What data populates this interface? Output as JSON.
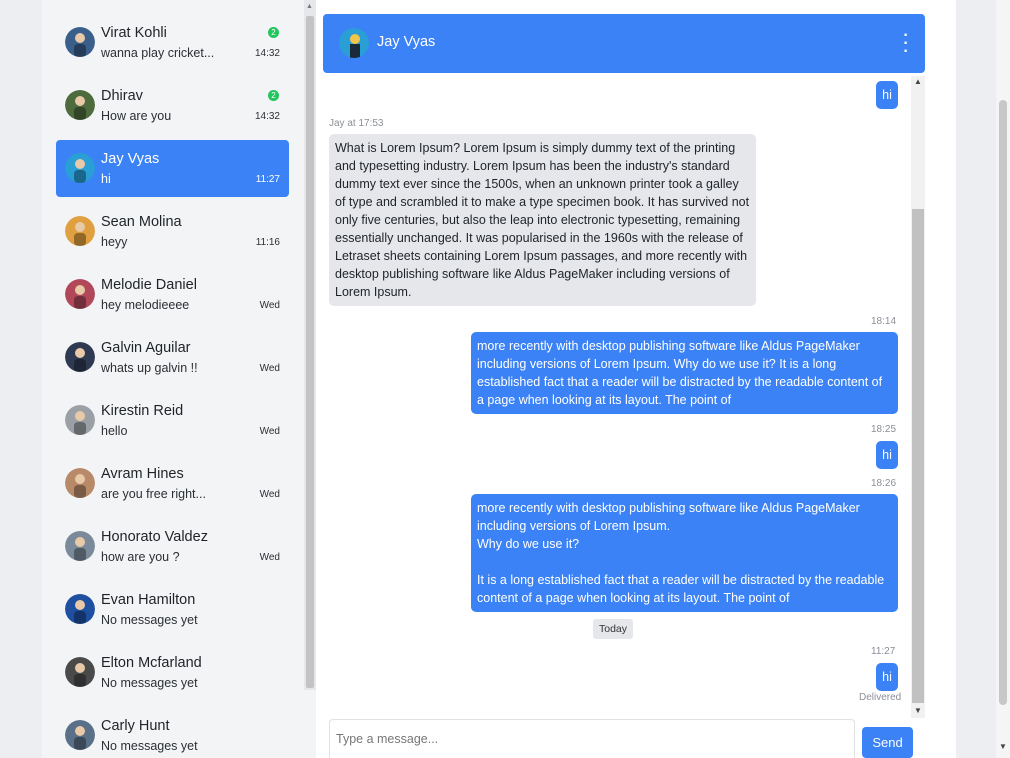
{
  "contacts": [
    {
      "name": "Virat Kohli",
      "preview": "wanna play cricket...",
      "time": "14:32",
      "unread": "2",
      "avatar_color": "#3a5f8a"
    },
    {
      "name": "Dhirav",
      "preview": "How are you",
      "time": "14:32",
      "unread": "2",
      "avatar_color": "#4d6b3c"
    },
    {
      "name": "Jay Vyas",
      "preview": "hi",
      "time": "11:27",
      "unread": "",
      "avatar_color": "#2a9fd6",
      "active": true
    },
    {
      "name": "Sean Molina",
      "preview": "heyy",
      "time": "11:16",
      "unread": "",
      "avatar_color": "#e0a040"
    },
    {
      "name": "Melodie Daniel",
      "preview": "hey melodieeee",
      "time": "Wed",
      "unread": "",
      "avatar_color": "#b0485a"
    },
    {
      "name": "Galvin Aguilar",
      "preview": "whats up galvin !!",
      "time": "Wed",
      "unread": "",
      "avatar_color": "#2e3a52"
    },
    {
      "name": "Kirestin Reid",
      "preview": "hello",
      "time": "Wed",
      "unread": "",
      "avatar_color": "#9aa0a6"
    },
    {
      "name": "Avram Hines",
      "preview": "are you free right...",
      "time": "Wed",
      "unread": "",
      "avatar_color": "#b88a6a"
    },
    {
      "name": "Honorato Valdez",
      "preview": "how are you ?",
      "time": "Wed",
      "unread": "",
      "avatar_color": "#7a8a9a"
    },
    {
      "name": "Evan Hamilton",
      "preview": "No messages yet",
      "time": "",
      "unread": "",
      "avatar_color": "#1f4fa0"
    },
    {
      "name": "Elton Mcfarland",
      "preview": "No messages yet",
      "time": "",
      "unread": "",
      "avatar_color": "#4a4a4a"
    },
    {
      "name": "Carly Hunt",
      "preview": "No messages yet",
      "time": "",
      "unread": "",
      "avatar_color": "#5a6f88"
    }
  ],
  "chat": {
    "title": "Jay Vyas",
    "menu_icon": "kebab-menu-icon"
  },
  "messages": {
    "m1": "hi",
    "m2_meta": "Jay at 17:53",
    "m2": "What is Lorem Ipsum?  Lorem Ipsum is simply dummy text of the printing and typesetting industry. Lorem Ipsum has been the industry's standard dummy text ever since the 1500s, when an unknown printer took a galley of type and scrambled it to make a type specimen book. It has survived not only five centuries, but also the leap into electronic typesetting, remaining essentially unchanged. It was popularised in the 1960s with the release of Letraset sheets containing Lorem Ipsum passages, and more recently with desktop publishing software like Aldus PageMaker including versions of Lorem Ipsum.",
    "m3_meta": "18:14",
    "m3": "more recently with desktop publishing software like Aldus PageMaker including versions of Lorem Ipsum. Why do we use it?  It is a long established fact that a reader will be distracted by the readable content of a page when looking at its layout. The point of",
    "m4_meta": "18:25",
    "m4": "hi",
    "m5_meta": "18:26",
    "m5_l1": "more recently with desktop publishing software like Aldus PageMaker including versions of Lorem Ipsum.",
    "m5_l2": "Why do we use it?",
    "m5_l3": "It is a long established fact that a reader will be distracted by the readable content of a page when looking at its layout. The point of",
    "day_separator": "Today",
    "m6_meta": "11:27",
    "m6": "hi",
    "m6_status": "Delivered"
  },
  "composer": {
    "placeholder": "Type a message...",
    "send_label": "Send"
  }
}
